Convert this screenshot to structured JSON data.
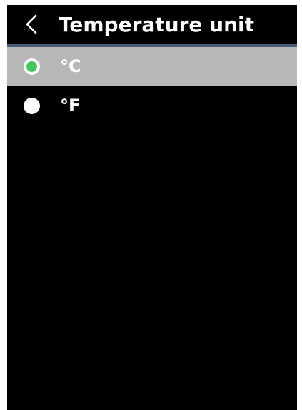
{
  "header": {
    "title": "Temperature unit",
    "back_icon": "chevron-left-icon"
  },
  "options": [
    {
      "label": "°C",
      "selected": true
    },
    {
      "label": "°F",
      "selected": false
    }
  ],
  "colors": {
    "background": "#000000",
    "selected_row": "#b7b7b7",
    "radio_selected": "#3ec95a",
    "radio_ring": "#ffffff",
    "header_divider": "#4a5b7a",
    "text": "#ffffff"
  }
}
